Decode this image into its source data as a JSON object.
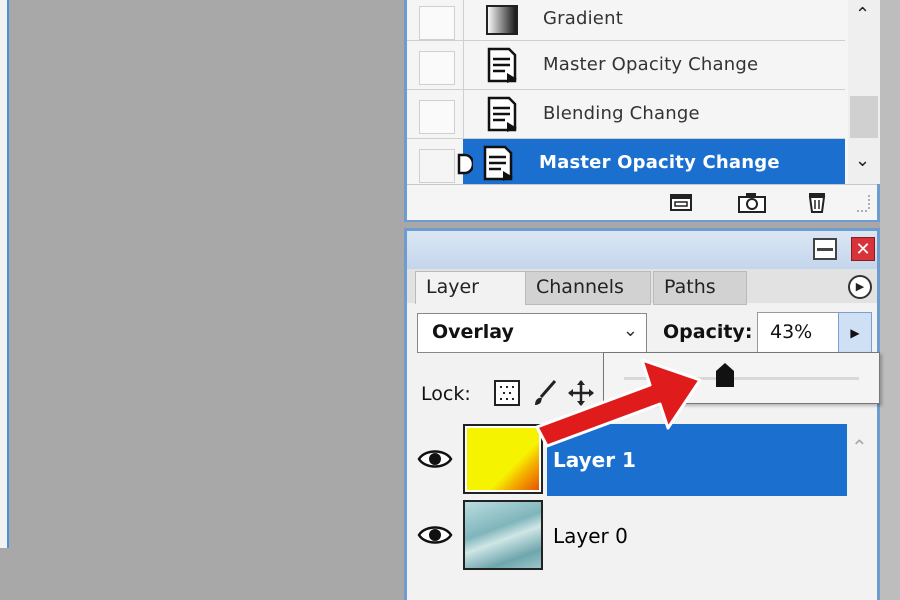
{
  "history": {
    "items": [
      {
        "label": "Gradient",
        "icon": "gradient-icon",
        "selected": false
      },
      {
        "label": "Master Opacity Change",
        "icon": "history-state-icon",
        "selected": false
      },
      {
        "label": "Blending Change",
        "icon": "history-state-icon",
        "selected": false
      },
      {
        "label": "Master Opacity Change",
        "icon": "history-state-icon",
        "selected": true
      }
    ],
    "footer_icons": [
      "new-document-from-state-icon",
      "snapshot-camera-icon",
      "trash-icon"
    ]
  },
  "layers_panel": {
    "tabs": [
      "Layer",
      "Channels",
      "Paths"
    ],
    "active_tab": "Layer",
    "blend_mode": "Overlay",
    "opacity_label": "Opacity:",
    "opacity_value": "43%",
    "opacity_slider_fraction": 0.43,
    "lock_label": "Lock:",
    "layers": [
      {
        "name": "Layer 1",
        "selected": true,
        "visible": true
      },
      {
        "name": "Layer 0",
        "selected": false,
        "visible": true
      }
    ]
  },
  "colors": {
    "selection": "#1a6fcf",
    "annotation_arrow": "#e01b1b",
    "panel_border": "#6f9ccf"
  }
}
